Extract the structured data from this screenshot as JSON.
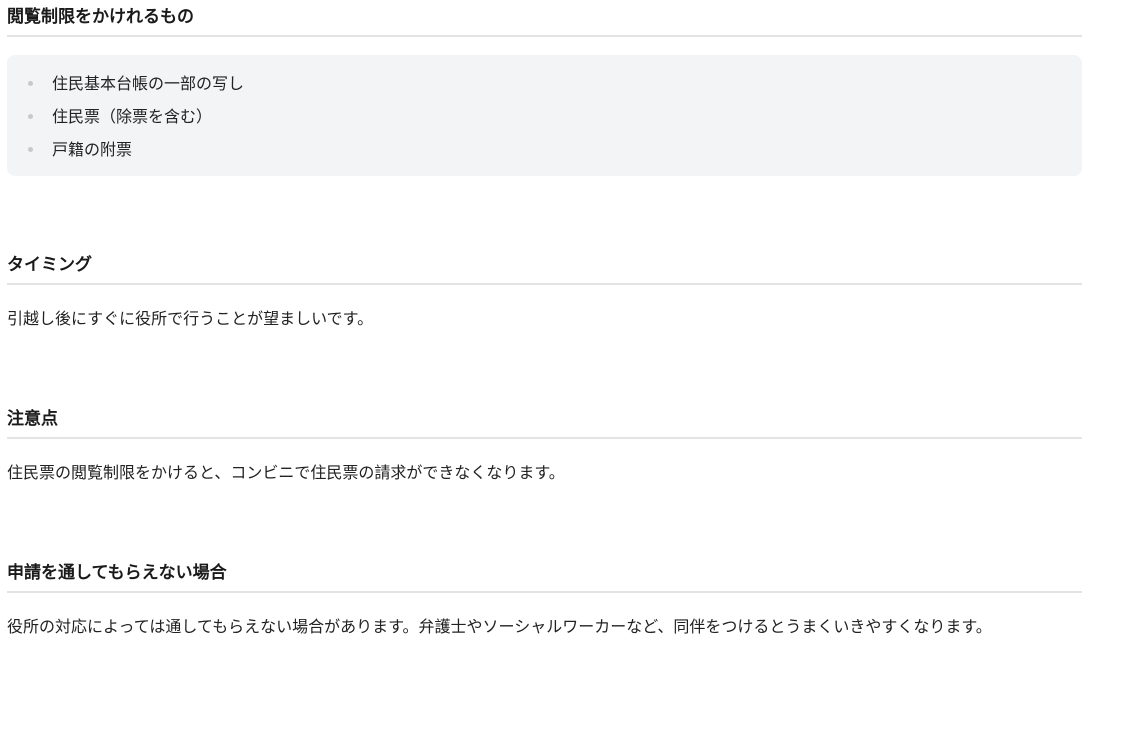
{
  "sections": {
    "restrictable": {
      "heading": "閲覧制限をかけれるもの",
      "items": [
        "住民基本台帳の一部の写し",
        "住民票（除票を含む）",
        "戸籍の附票"
      ]
    },
    "timing": {
      "heading": "タイミング",
      "body": "引越し後にすぐに役所で行うことが望ましいです。"
    },
    "caution": {
      "heading": "注意点",
      "body": "住民票の閲覧制限をかけると、コンビニで住民票の請求ができなくなります。"
    },
    "rejected": {
      "heading": "申請を通してもらえない場合",
      "body": "役所の対応によっては通してもらえない場合があります。弁護士やソーシャルワーカーなど、同伴をつけるとうまくいきやすくなります。"
    }
  }
}
